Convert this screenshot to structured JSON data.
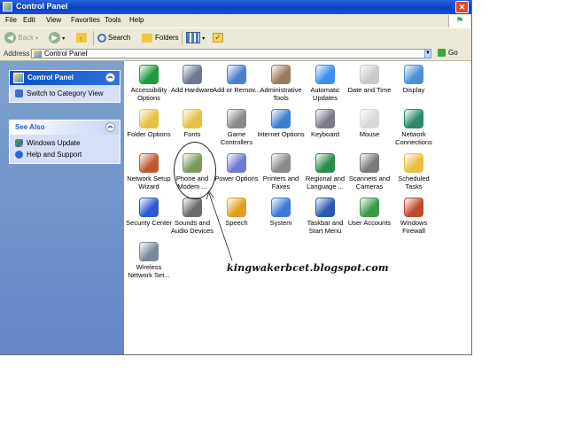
{
  "window": {
    "title": "Control Panel"
  },
  "menubar": {
    "items": [
      "File",
      "Edit",
      "View",
      "Favorites",
      "Tools",
      "Help"
    ]
  },
  "toolbar": {
    "back_label": "Back",
    "search_label": "Search",
    "folders_label": "Folders"
  },
  "address": {
    "label": "Address",
    "value": "Control Panel",
    "go_label": "Go"
  },
  "left_pane": {
    "control_panel": {
      "title": "Control Panel",
      "link": "Switch to Category View"
    },
    "see_also": {
      "title": "See Also",
      "links": [
        "Windows Update",
        "Help and Support"
      ]
    }
  },
  "items": [
    {
      "label": "Accessibility Options",
      "icon": "accessibility-icon",
      "color": "#1e9a3a"
    },
    {
      "label": "Add Hardware",
      "icon": "add-hardware-icon",
      "color": "#6b7a8c"
    },
    {
      "label": "Add or Remov...",
      "icon": "add-remove-programs-icon",
      "color": "#4a7fd0"
    },
    {
      "label": "Administrative Tools",
      "icon": "administrative-tools-icon",
      "color": "#9a7a5a"
    },
    {
      "label": "Automatic Updates",
      "icon": "automatic-updates-icon",
      "color": "#3a8df0"
    },
    {
      "label": "Date and Time",
      "icon": "date-time-icon",
      "color": "#c9c9c9"
    },
    {
      "label": "Display",
      "icon": "display-icon",
      "color": "#4a90d8"
    },
    {
      "label": "Folder Options",
      "icon": "folder-options-icon",
      "color": "#e8c040"
    },
    {
      "label": "Fonts",
      "icon": "fonts-icon",
      "color": "#e8c040"
    },
    {
      "label": "Game Controllers",
      "icon": "game-controllers-icon",
      "color": "#8a8a8a"
    },
    {
      "label": "Internet Options",
      "icon": "internet-options-icon",
      "color": "#3a7fd0"
    },
    {
      "label": "Keyboard",
      "icon": "keyboard-icon",
      "color": "#7a7a8a"
    },
    {
      "label": "Mouse",
      "icon": "mouse-icon",
      "color": "#d8d8d8"
    },
    {
      "label": "Network Connections",
      "icon": "network-connections-icon",
      "color": "#2a8a6a"
    },
    {
      "label": "Network Setup Wizard",
      "icon": "network-setup-wizard-icon",
      "color": "#c05a2a"
    },
    {
      "label": "Phone and Modem ...",
      "icon": "phone-modem-icon",
      "color": "#7a9a5a"
    },
    {
      "label": "Power Options",
      "icon": "power-options-icon",
      "color": "#6a7ad0"
    },
    {
      "label": "Printers and Faxes",
      "icon": "printers-faxes-icon",
      "color": "#8a8a8a"
    },
    {
      "label": "Regional and Language ...",
      "icon": "regional-language-icon",
      "color": "#2a8a4a"
    },
    {
      "label": "Scanners and Cameras",
      "icon": "scanners-cameras-icon",
      "color": "#7a7a7a"
    },
    {
      "label": "Scheduled Tasks",
      "icon": "scheduled-tasks-icon",
      "color": "#e8c040"
    },
    {
      "label": "Security Center",
      "icon": "security-center-icon",
      "color": "#2a5ad0"
    },
    {
      "label": "Sounds and Audio Devices",
      "icon": "sounds-audio-icon",
      "color": "#6a6a6a"
    },
    {
      "label": "Speech",
      "icon": "speech-icon",
      "color": "#e0a020"
    },
    {
      "label": "System",
      "icon": "system-icon",
      "color": "#3a7ad8"
    },
    {
      "label": "Taskbar and Start Menu",
      "icon": "taskbar-start-menu-icon",
      "color": "#2a5ab0"
    },
    {
      "label": "User Accounts",
      "icon": "user-accounts-icon",
      "color": "#3a9a4a"
    },
    {
      "label": "Windows Firewall",
      "icon": "windows-firewall-icon",
      "color": "#c04a2a"
    },
    {
      "label": "Wireless Network Set...",
      "icon": "wireless-network-setup-icon",
      "color": "#7a8a9a"
    }
  ],
  "annotation": {
    "text": "kingwakerbcet.blogspot.com"
  },
  "colors": {
    "titlebar": "#0a3fbf",
    "left_pane": "#7da2ce",
    "chrome": "#ece9d8"
  }
}
